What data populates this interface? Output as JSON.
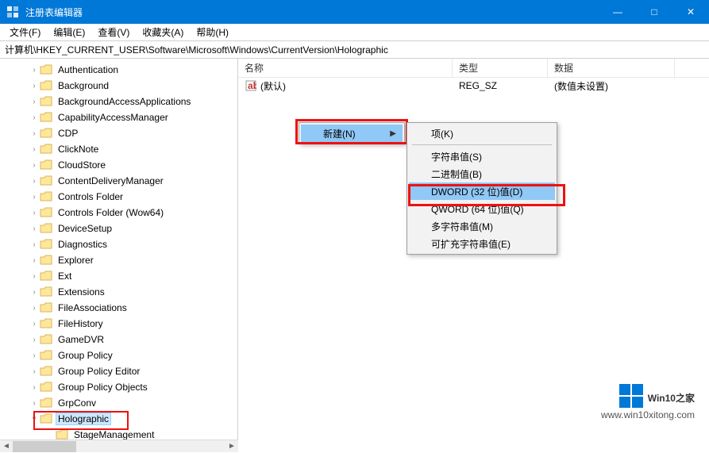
{
  "title": "注册表编辑器",
  "win_buttons": {
    "min": "—",
    "max": "□",
    "close": "✕"
  },
  "menu": [
    "文件(F)",
    "编辑(E)",
    "查看(V)",
    "收藏夹(A)",
    "帮助(H)"
  ],
  "address": "计算机\\HKEY_CURRENT_USER\\Software\\Microsoft\\Windows\\CurrentVersion\\Holographic",
  "tree": {
    "items": [
      "Authentication",
      "Background",
      "BackgroundAccessApplications",
      "CapabilityAccessManager",
      "CDP",
      "ClickNote",
      "CloudStore",
      "ContentDeliveryManager",
      "Controls Folder",
      "Controls Folder (Wow64)",
      "DeviceSetup",
      "Diagnostics",
      "Explorer",
      "Ext",
      "Extensions",
      "FileAssociations",
      "FileHistory",
      "GameDVR",
      "Group Policy",
      "Group Policy Editor",
      "Group Policy Objects",
      "GrpConv",
      "Holographic"
    ],
    "selected_index": 22,
    "child": "StageManagement"
  },
  "columns": {
    "name": "名称",
    "type": "类型",
    "data": "数据"
  },
  "col_widths": {
    "name": 270,
    "type": 120,
    "data": 160
  },
  "values": [
    {
      "name": "(默认)",
      "type": "REG_SZ",
      "data": "(数值未设置)"
    }
  ],
  "context_new": {
    "label": "新建(N)"
  },
  "context_sub": {
    "items": [
      {
        "label": "项(K)"
      },
      {
        "sep": true
      },
      {
        "label": "字符串值(S)"
      },
      {
        "label": "二进制值(B)"
      },
      {
        "label": "DWORD (32 位)值(D)",
        "hl": true
      },
      {
        "label": "QWORD (64 位)值(Q)"
      },
      {
        "label": "多字符串值(M)"
      },
      {
        "label": "可扩充字符串值(E)"
      }
    ]
  },
  "watermark": {
    "text1": "Win10",
    "text2": "之家",
    "url": "www.win10xitong.com"
  }
}
